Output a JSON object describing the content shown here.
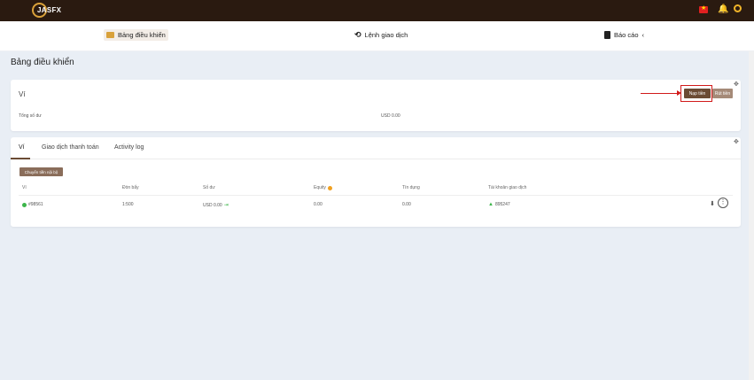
{
  "brand": {
    "logo_text": "JASFX"
  },
  "colors": {
    "header_bg": "#2a1a10",
    "accent": "#6b4b34",
    "annotation": "#d11a1a",
    "status_green": "#3cb54a"
  },
  "nav": {
    "items": [
      {
        "label": "Bảng điều khiển",
        "icon": "dashboard-icon"
      },
      {
        "label": "Lệnh giao dịch",
        "icon": "history-icon"
      },
      {
        "label": "Báo cáo",
        "icon": "report-icon",
        "suffix": "‹"
      }
    ]
  },
  "page": {
    "title": "Bảng điều khiển"
  },
  "wallet": {
    "title": "Ví",
    "deposit_label": "Nạp tiền",
    "withdraw_label": "Rút tiền",
    "balance_label": "Tổng số dư",
    "balance_value": "USD 0.00"
  },
  "tabs": [
    {
      "label": "Ví",
      "active": true
    },
    {
      "label": "Giao dịch thanh toán",
      "active": false
    },
    {
      "label": "Activity log",
      "active": false
    }
  ],
  "table": {
    "transfer_label": "Chuyển tiền nội bộ",
    "headers": [
      "Ví",
      "Đòn bẩy",
      "Số dư",
      "Equity",
      "Tín dụng",
      "Tài khoản giao dịch"
    ],
    "rows": [
      {
        "wallet": "#98561",
        "leverage": "1:500",
        "balance": "USD 0.00",
        "equity": "0.00",
        "credit": "0.00",
        "trading_account": "895247"
      }
    ]
  }
}
